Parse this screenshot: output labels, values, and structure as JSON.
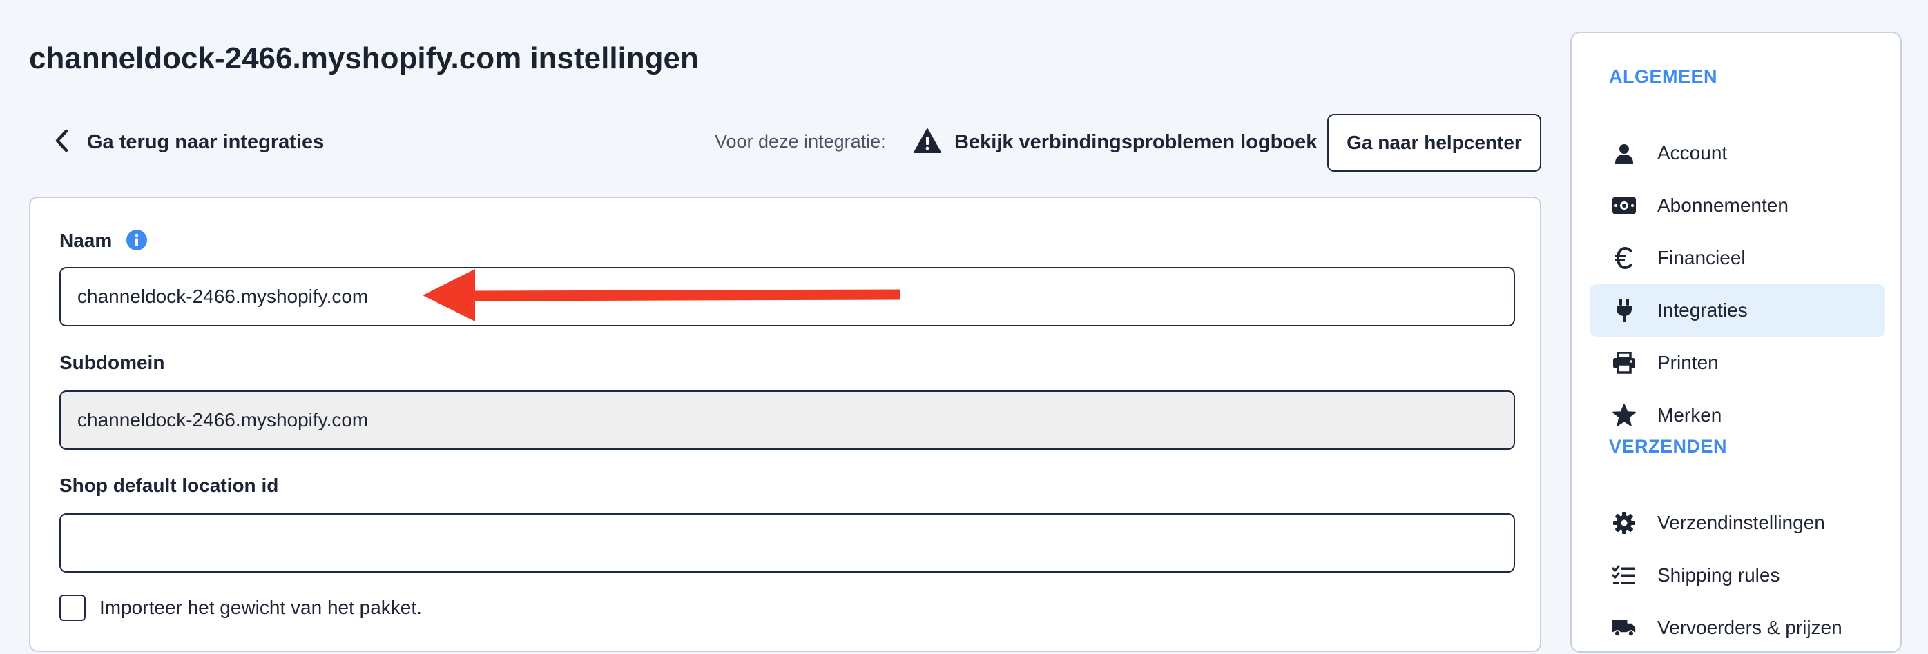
{
  "page": {
    "title": "channeldock-2466.myshopify.com instellingen"
  },
  "toolbar": {
    "back_label": "Ga terug naar integraties",
    "integration_label": "Voor deze integratie:",
    "logbook_label": "Bekijk verbindingsproblemen logboek",
    "help_label": "Ga naar helpcenter"
  },
  "form": {
    "name_label": "Naam",
    "name_value": "channeldock-2466.myshopify.com",
    "subdomain_label": "Subdomein",
    "subdomain_value": "channeldock-2466.myshopify.com",
    "location_label": "Shop default location id",
    "location_value": "",
    "weight_checkbox_label": "Importeer het gewicht van het pakket.",
    "weight_checkbox_checked": false
  },
  "annotation": {
    "arrow_color": "#f03a26"
  },
  "colors": {
    "accent": "#3d8af0",
    "text": "#1d2433",
    "active_bg": "#e5f0fd"
  },
  "sidebar": {
    "section_general": "ALGEMEEN",
    "section_shipping": "VERZENDEN",
    "items": [
      {
        "label": "Account",
        "icon": "user-icon"
      },
      {
        "label": "Abonnementen",
        "icon": "money-icon"
      },
      {
        "label": "Financieel",
        "icon": "euro-icon"
      },
      {
        "label": "Integraties",
        "icon": "plug-icon",
        "active": true
      },
      {
        "label": "Printen",
        "icon": "printer-icon"
      },
      {
        "label": "Merken",
        "icon": "star-icon"
      },
      {
        "label": "Verzendinstellingen",
        "icon": "gear-icon"
      },
      {
        "label": "Shipping rules",
        "icon": "checklist-icon"
      },
      {
        "label": "Vervoerders & prijzen",
        "icon": "truck-icon"
      }
    ]
  }
}
